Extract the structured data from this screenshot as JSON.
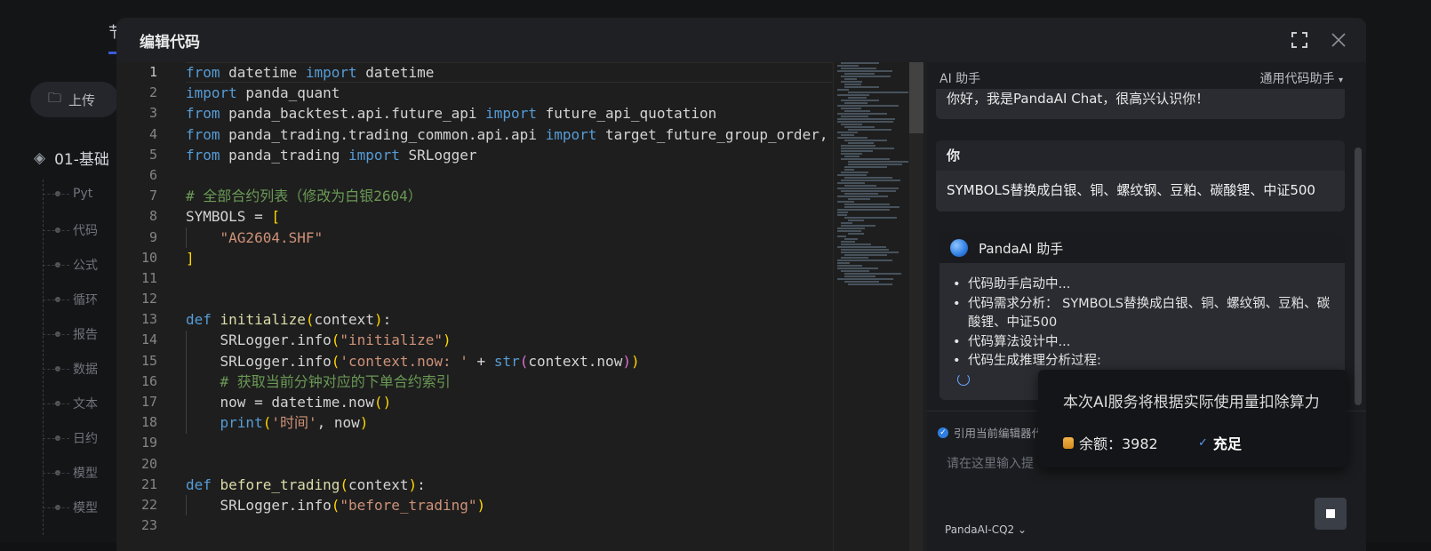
{
  "background": {
    "tab_label": "节",
    "upload_label": "上传",
    "section_title": "01-基础",
    "list_items": [
      "Pyt",
      "代码",
      "公式",
      "循环",
      "报告",
      "数据",
      "文本",
      "日约",
      "模型",
      "模型"
    ]
  },
  "modal": {
    "title": "编辑代码"
  },
  "editor": {
    "line_numbers": [
      "1",
      "2",
      "3",
      "4",
      "5",
      "6",
      "7",
      "8",
      "9",
      "10",
      "11",
      "12",
      "13",
      "14",
      "15",
      "16",
      "17",
      "18",
      "19",
      "20",
      "21",
      "22",
      "23"
    ],
    "active_line": 1,
    "lines": [
      "from datetime import datetime",
      "import panda_quant",
      "from panda_backtest.api.future_api import future_api_quotation",
      "from panda_trading.trading_common.api.api import target_future_group_order, bu",
      "from panda_trading import SRLogger",
      "",
      "# 全部合约列表（修改为白银2604）",
      "SYMBOLS = [",
      "    \"AG2604.SHF\"",
      "]",
      "",
      "",
      "def initialize(context):",
      "    SRLogger.info(\"initialize\")",
      "    SRLogger.info('context.now: ' + str(context.now))",
      "    # 获取当前分钟对应的下单合约索引",
      "    now = datetime.now()",
      "    print('时间', now)",
      "",
      "",
      "def before_trading(context):",
      "    SRLogger.info(\"before_trading\")",
      ""
    ]
  },
  "assistant": {
    "title": "AI 助手",
    "mode": "通用代码助手",
    "greeting": "你好，我是PandaAI Chat，很高兴认识你！",
    "user_label": "你",
    "user_message": "SYMBOLS替换成白银、铜、螺纹钢、豆粕、碳酸锂、中证500",
    "ai_label": "PandaAI 助手",
    "ai_steps": [
      "代码助手启动中...",
      "代码需求分析： SYMBOLS替换成白银、铜、螺纹钢、豆粕、碳酸锂、中证500",
      "代码算法设计中...",
      "代码生成推理分析过程:"
    ],
    "reference_label": "引用当前编辑器代",
    "input_placeholder": "请在这里输入提",
    "model_name": "PandaAI-CQ2"
  },
  "popover": {
    "notice": "本次AI服务将根据实际使用量扣除算力",
    "balance_label": "余额：3982",
    "recharge_label": "充足"
  },
  "colors": {
    "accent": "#2f7de1",
    "keyword": "#569cd6",
    "string": "#ce9178",
    "comment": "#6a9955"
  }
}
